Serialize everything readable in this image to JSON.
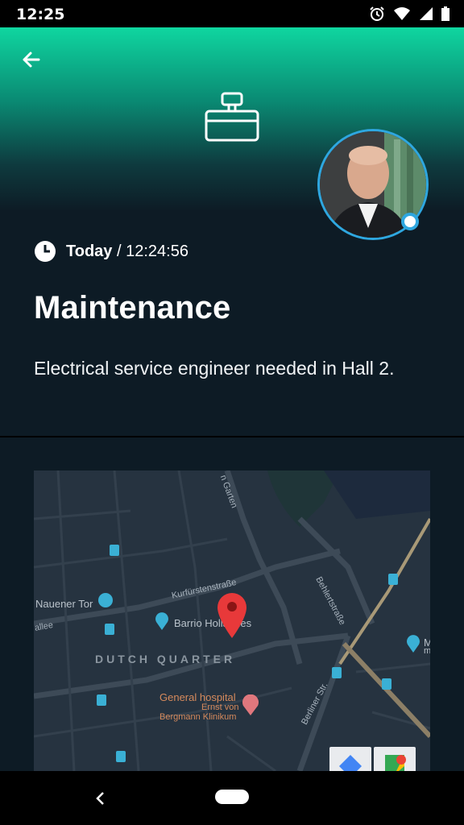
{
  "status_bar": {
    "time": "12:25"
  },
  "detail": {
    "date_label": "Today",
    "separator": " / ",
    "time": "12:24:56",
    "title": "Maintenance",
    "description": "Electrical service engineer needed in Hall 2."
  },
  "map": {
    "district": "DUTCH QUARTER",
    "labels": {
      "nauener_tor": "Nauener Tor",
      "barrio": "Barrio Hollandes",
      "hospital": "General hospital",
      "hospital_sub1": "Ernst von",
      "hospital_sub2": "Bergmann Klinikum",
      "allee": "allee",
      "garten": "n Garten",
      "kurfuersten": "Kurfürstenstraße",
      "behlert": "Behlertstraße",
      "berliner": "Berliner Str.",
      "right_m": "M",
      "right_m2": "m"
    }
  },
  "colors": {
    "accent": "#2ea7e0",
    "header_top": "#0fd6a0",
    "background": "#0d1b25",
    "marker": "#e8393a"
  }
}
